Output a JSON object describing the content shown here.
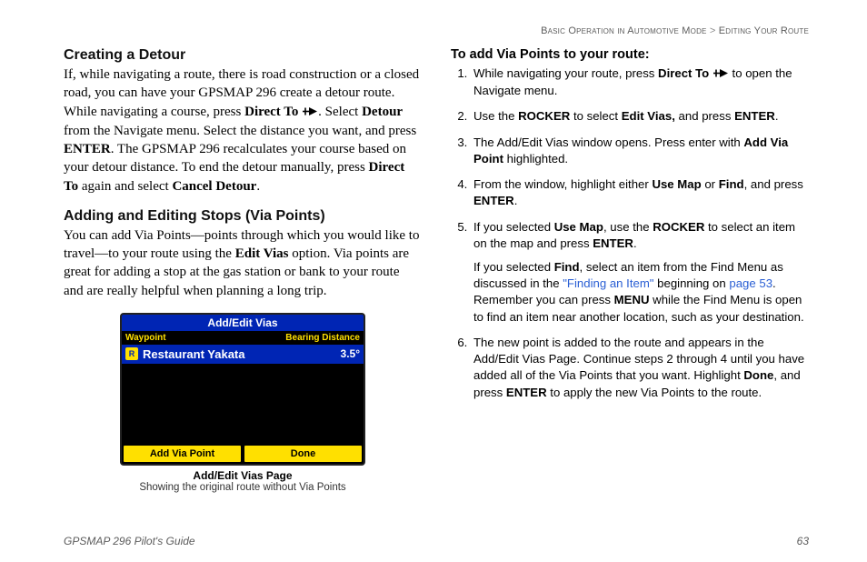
{
  "breadcrumb": {
    "section": "Basic Operation in Automotive Mode",
    "sep": ">",
    "sub": "Editing Your Route"
  },
  "left": {
    "h1": "Creating a Detour",
    "p1a": "If, while navigating a route, there is road construction or a closed road, you can have your GPSMAP 296 create a detour route. While navigating a course, press ",
    "p1b": "Direct To ",
    "p1c": ". Select ",
    "p1d": "Detour",
    "p1e": " from the Navigate menu. Select the distance you want, and press ",
    "p1f": "ENTER",
    "p1g": ". The GPSMAP 296 recalculates your course based on your detour distance. To end the detour manually, press ",
    "p1h": "Direct To",
    "p1i": " again and select ",
    "p1j": "Cancel Detour",
    "p1k": ".",
    "h2": "Adding and Editing Stops (Via Points)",
    "p2a": "You can add Via Points—points through which you would like to travel—to your route using the ",
    "p2b": "Edit Vias",
    "p2c": " option. Via points are great for adding a stop at the gas station or bank to your route and are really helpful when planning a long trip.",
    "fig": {
      "title": "Add/Edit Vias",
      "hdr_wp": "Waypoint",
      "hdr_bd": "Bearing  Distance",
      "row_icon": "R",
      "row_name": "Restaurant Yakata",
      "row_dist": "3.5°",
      "btn1": "Add Via Point",
      "btn2": "Done",
      "cap1": "Add/Edit Vias Page",
      "cap2": "Showing the original route without Via Points"
    }
  },
  "right": {
    "heading": "To add Via Points to your route:",
    "steps": {
      "s1a": "While navigating your route, press ",
      "s1b": "Direct To ",
      "s1c": " to open the Navigate menu.",
      "s2a": "Use the ",
      "s2b": "ROCKER",
      "s2c": " to select ",
      "s2d": "Edit Vias,",
      "s2e": " and press ",
      "s2f": "ENTER",
      "s2g": ".",
      "s3a": "The Add/Edit Vias window opens. Press enter with ",
      "s3b": "Add Via Point",
      "s3c": " highlighted.",
      "s4a": "From the window, highlight either ",
      "s4b": "Use Map",
      "s4c": " or ",
      "s4d": "Find",
      "s4e": ", and press ",
      "s4f": "ENTER",
      "s4g": ".",
      "s5a": "If you selected ",
      "s5b": "Use Map",
      "s5c": ", use the ",
      "s5d": "ROCKER",
      "s5e": " to select an item on the map and press ",
      "s5f": "ENTER",
      "s5g": ".",
      "s5x_a": "If you selected ",
      "s5x_b": "Find",
      "s5x_c": ", select an item from the Find Menu as discussed in the ",
      "s5x_link1": "\"Finding an Item\"",
      "s5x_d": " beginning on ",
      "s5x_link2": "page 53",
      "s5x_e": ". Remember you can press ",
      "s5x_f": "MENU",
      "s5x_g": " while the Find Menu is open to find an item near another location, such as your destination.",
      "s6a": "The new point is added to the route and appears in the Add/Edit Vias Page. Continue steps 2 through 4 until you have added all of the Via Points that you want. Highlight ",
      "s6b": "Done",
      "s6c": ", and press ",
      "s6d": "ENTER",
      "s6e": " to apply the new Via Points to the route."
    }
  },
  "footer": {
    "guide": "GPSMAP 296 Pilot's Guide",
    "page": "63"
  }
}
